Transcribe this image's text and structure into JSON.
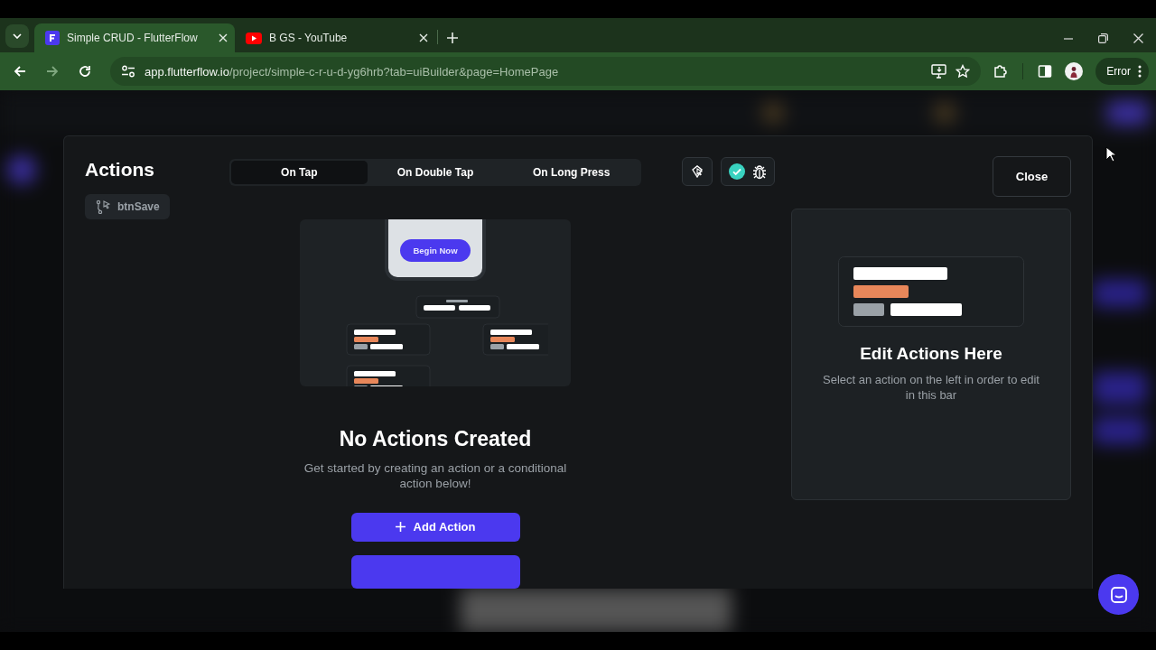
{
  "browser": {
    "tabs": [
      {
        "title": "Simple CRUD - FlutterFlow",
        "selected": true,
        "kind": "flutterflow"
      },
      {
        "title": "B GS - YouTube",
        "selected": false,
        "kind": "youtube"
      }
    ],
    "url_host": "app.flutterflow.io",
    "url_path": "/project/simple-c-r-u-d-yg6hrb?tab=uiBuilder&page=HomePage",
    "profile_status": "Error"
  },
  "modal": {
    "title": "Actions",
    "widget_chip": "btnSave",
    "triggers": [
      {
        "label": "On Tap",
        "selected": true
      },
      {
        "label": "On Double Tap",
        "selected": false
      },
      {
        "label": "On Long Press",
        "selected": false
      }
    ],
    "validation_passed": true,
    "illustration_button": "Begin Now",
    "empty_title": "No Actions Created",
    "empty_text": "Get started by creating an action or a conditional action below!",
    "add_action_button": "Add Action",
    "close_button": "Close",
    "editor_title": "Edit Actions Here",
    "editor_text": "Select an action on the left in order to edit in this bar"
  }
}
